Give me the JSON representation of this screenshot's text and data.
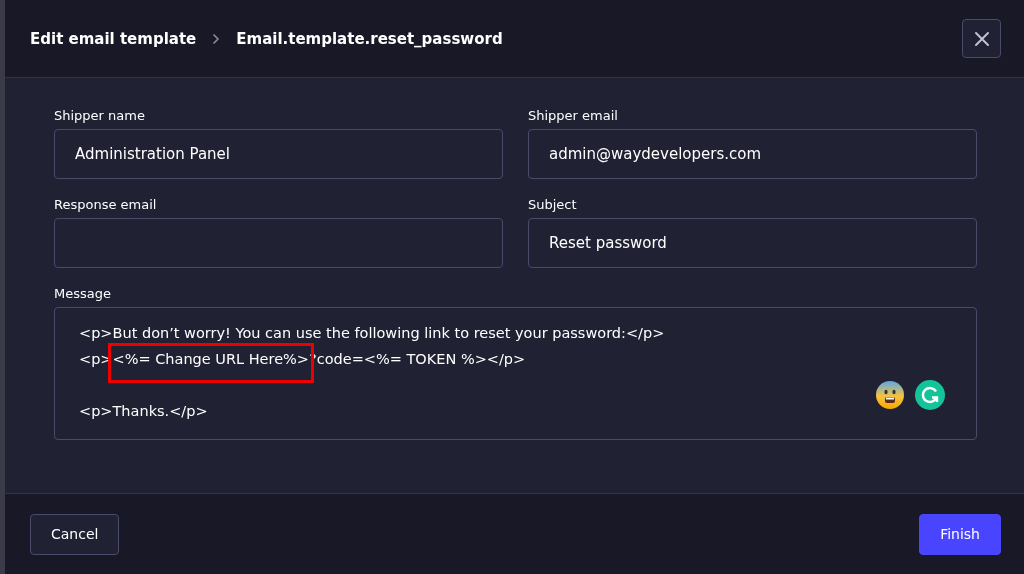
{
  "header": {
    "breadcrumb": [
      "Edit email template",
      "Email.template.reset_password"
    ]
  },
  "fields": [
    {
      "label": "Shipper name",
      "value": "Administration Panel"
    },
    {
      "label": "Shipper email",
      "value": "admin@waydevelopers.com"
    },
    {
      "label": "Response email"
    },
    {
      "label": "Subject",
      "value": "Reset password"
    }
  ],
  "message": {
    "label": "Message",
    "value": "<p>But don’t worry! You can use the following link to reset your password:</p>\n<p><%= Change URL Here%>?code=<%= TOKEN %></p>\n\n<p>Thanks.</p>"
  },
  "highlight_box": {
    "color": "#ee0000"
  },
  "footer": {
    "cancel": "Cancel",
    "finish": "Finish"
  }
}
